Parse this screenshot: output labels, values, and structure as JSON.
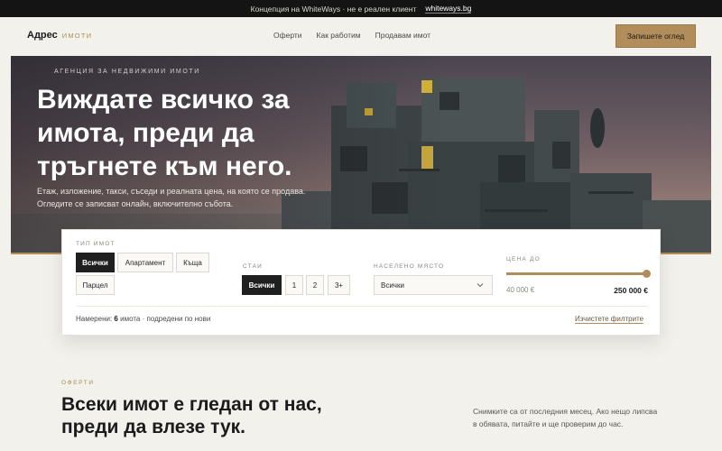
{
  "topbar": {
    "text": "Концепция на WhiteWays · не е реален клиент",
    "link": "whiteways.bg"
  },
  "header": {
    "logo_main": "Адрес",
    "logo_sub": "имоти",
    "nav": [
      "Оферти",
      "Как работим",
      "Продавам имот"
    ],
    "cta": "Запишете оглед"
  },
  "hero": {
    "eyebrow": "АГЕНЦИЯ ЗА НЕДВИЖИМИ ИМОТИ",
    "title": "Виждате всичко за имота, преди да тръгнете към него.",
    "description": "Етаж, изложение, такси, съседи и реалната цена, на която се продава. Огледите се записват онлайн, включително събота."
  },
  "filters": {
    "type_label": "ТИП ИМОТ",
    "types": [
      "Всички",
      "Апартамент",
      "Къща",
      "Парцел"
    ],
    "rooms_label": "СТАИ",
    "rooms": [
      "Всички",
      "1",
      "2",
      "3+"
    ],
    "place_label": "НАСЕЛЕНО МЯСТО",
    "place_value": "Всички",
    "price_label": "ЦЕНА ДО",
    "price_min": "40 000 €",
    "price_max": "250 000 €",
    "price_fraction": 1.0,
    "results_prefix": "Намерени:",
    "results_count": "6",
    "results_suffix": "имота · подредени по нови",
    "clear": "Изчистете филтрите"
  },
  "offers": {
    "eyebrow": "ОФЕРТИ",
    "title": "Всеки имот е гледан от нас, преди да влезе тук.",
    "description": "Снимките са от последния месец. Ако нещо липсва в обявата, питайте и ще проверим до час."
  },
  "colors": {
    "accent": "#b08d5b",
    "dark": "#1f1f1f",
    "background": "#f3f1ec"
  }
}
